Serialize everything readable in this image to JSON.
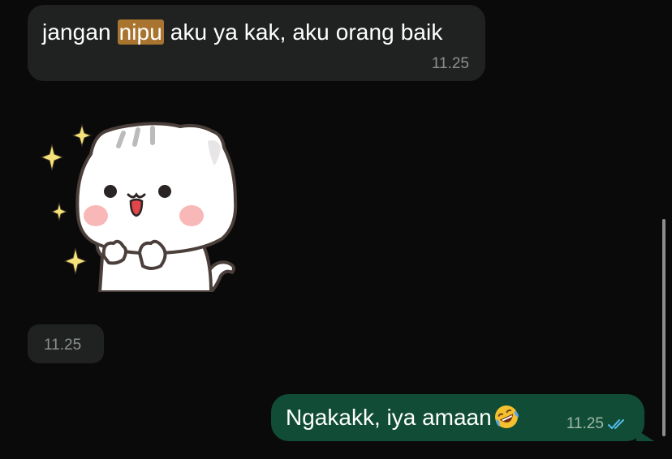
{
  "messages": {
    "incoming_text": {
      "before": "jangan ",
      "highlight": "nipu",
      "after": " aku ya kak, aku orang baik",
      "time": "11.25"
    },
    "incoming_sticker": {
      "icon": "cat-sticker-icon",
      "time": "11.25"
    },
    "outgoing_text": {
      "text": "Ngakakk, iya amaan",
      "emoji": "rolling-on-floor-laughing-icon",
      "time": "11.25",
      "status_icon": "double-check-icon",
      "status_color": "#53bdeb"
    }
  },
  "colors": {
    "background": "#0b0a0b",
    "incoming_bubble": "#202222",
    "outgoing_bubble": "#114d36",
    "highlight": "#a8742f"
  }
}
